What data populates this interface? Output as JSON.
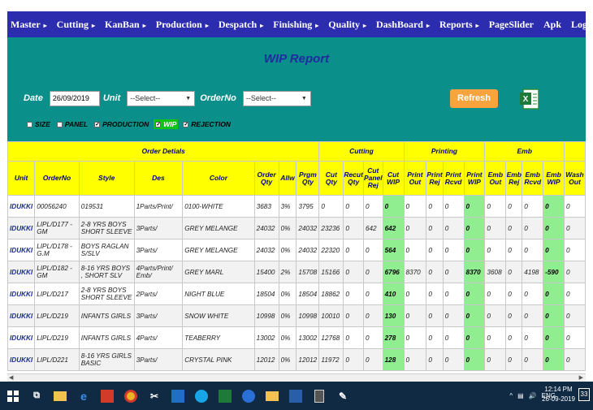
{
  "nav": [
    {
      "label": "Master"
    },
    {
      "label": "Cutting"
    },
    {
      "label": "KanBan"
    },
    {
      "label": "Production"
    },
    {
      "label": "Despatch"
    },
    {
      "label": "Finishing"
    },
    {
      "label": "Quality"
    },
    {
      "label": "DashBoard"
    },
    {
      "label": "Reports"
    },
    {
      "label": "PageSlider"
    },
    {
      "label": "Apk"
    },
    {
      "label": "Logout"
    }
  ],
  "page_title": "WIP Report",
  "filters": {
    "date_label": "Date",
    "date_value": "26/09/2019",
    "unit_label": "Unit",
    "unit_value": "--Select--",
    "orderno_label": "OrderNo",
    "orderno_value": "--Select--",
    "refresh_label": "Refresh"
  },
  "checkboxes": [
    {
      "label": "SIZE",
      "checked": false
    },
    {
      "label": "PANEL",
      "checked": false
    },
    {
      "label": "PRODUCTION",
      "checked": true
    },
    {
      "label": "WIP",
      "checked": true
    },
    {
      "label": "REJECTION",
      "checked": true
    }
  ],
  "table": {
    "groups": [
      {
        "label": "Order Detials",
        "span": 8
      },
      {
        "label": "Cutting",
        "span": 4
      },
      {
        "label": "Printing",
        "span": 4
      },
      {
        "label": "Emb",
        "span": 4
      },
      {
        "label": "",
        "span": 1
      }
    ],
    "columns": [
      "Unit",
      "OrderNo",
      "Style",
      "Des",
      "Color",
      "Order Qty",
      "Allw",
      "Prgm Qty",
      "Cut Qty",
      "Recut Qty",
      "Cut Panel Rej",
      "Cut WIP",
      "Print Out",
      "Print Rej",
      "Print Rcvd",
      "Print WIP",
      "Emb Out",
      "Emb Rej",
      "Emb Rcvd",
      "Emb WIP",
      "Wash Out"
    ],
    "rows": [
      [
        "IDUKKI",
        "00056240",
        "019531",
        "1Parts/Print/",
        "0100-WHITE",
        "3683",
        "3%",
        "3795",
        "0",
        "0",
        "0",
        "0",
        "0",
        "0",
        "0",
        "0",
        "0",
        "0",
        "0",
        "0",
        "0"
      ],
      [
        "IDUKKI",
        "LIPL/D177 - GM",
        "2-8 YRS BOYS SHORT SLEEVE",
        "3Parts/",
        "GREY MELANGE",
        "24032",
        "0%",
        "24032",
        "23236",
        "0",
        "642",
        "642",
        "0",
        "0",
        "0",
        "0",
        "0",
        "0",
        "0",
        "0",
        "0"
      ],
      [
        "IDUKKI",
        "LIPL/D178 - G.M",
        "BOYS RAGLAN S/SLV",
        "3Parts/",
        "GREY MELANGE",
        "24032",
        "0%",
        "24032",
        "22320",
        "0",
        "0",
        "564",
        "0",
        "0",
        "0",
        "0",
        "0",
        "0",
        "0",
        "0",
        "0"
      ],
      [
        "IDUKKI",
        "LIPL/D182 - GM",
        "8-16 YRS BOYS , SHORT SLV",
        "4Parts/Print/ Emb/",
        "GREY MARL",
        "15400",
        "2%",
        "15708",
        "15166",
        "0",
        "0",
        "6796",
        "8370",
        "0",
        "0",
        "8370",
        "3608",
        "0",
        "4198",
        "-590",
        "0"
      ],
      [
        "IDUKKI",
        "LIPL/D217",
        "2-8 YRS BOYS SHORT SLEEVE",
        "2Parts/",
        "NIGHT BLUE",
        "18504",
        "0%",
        "18504",
        "18862",
        "0",
        "0",
        "410",
        "0",
        "0",
        "0",
        "0",
        "0",
        "0",
        "0",
        "0",
        "0"
      ],
      [
        "IDUKKI",
        "LIPL/D219",
        "INFANTS GIRLS",
        "3Parts/",
        "SNOW WHITE",
        "10998",
        "0%",
        "10998",
        "10010",
        "0",
        "0",
        "130",
        "0",
        "0",
        "0",
        "0",
        "0",
        "0",
        "0",
        "0",
        "0"
      ],
      [
        "IDUKKI",
        "LIPL/D219",
        "INFANTS GIRLS",
        "4Parts/",
        "TEABERRY",
        "13002",
        "0%",
        "13002",
        "12768",
        "0",
        "0",
        "278",
        "0",
        "0",
        "0",
        "0",
        "0",
        "0",
        "0",
        "0",
        "0"
      ],
      [
        "IDUKKI",
        "LIPL/D221",
        "8-16 YRS GIRLS BASIC",
        "3Parts/",
        "CRYSTAL PINK",
        "12012",
        "0%",
        "12012",
        "11972",
        "0",
        "0",
        "128",
        "0",
        "0",
        "0",
        "0",
        "0",
        "0",
        "0",
        "0",
        "0"
      ]
    ]
  },
  "taskbar": {
    "tray_lang": "ENG",
    "time": "12:14 PM",
    "date": "26-09-2019",
    "notifications": "33"
  }
}
